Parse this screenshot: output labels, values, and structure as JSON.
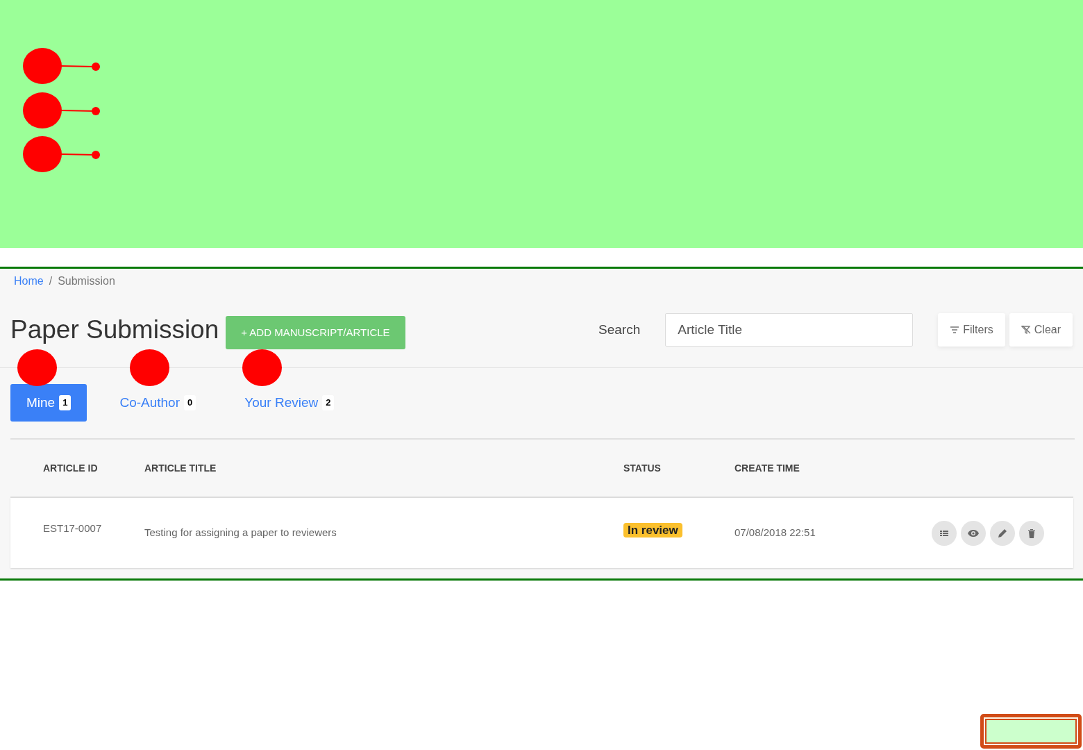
{
  "breadcrumb": [
    {
      "label": "Home",
      "kind": "link"
    },
    {
      "label": "/",
      "kind": "separator"
    },
    {
      "label": "Submission",
      "kind": "current"
    }
  ],
  "title": "Paper Submission",
  "add_button": "+ ADD MANUSCRIPT/ARTICLE",
  "search": {
    "label": "Search",
    "placeholder": "Article Title"
  },
  "filter_buttons": [
    {
      "kind": "filter",
      "label": "Filters"
    },
    {
      "kind": "clear",
      "label": "Clear"
    }
  ],
  "tabs": [
    {
      "label": "Mine",
      "count": "1",
      "selected": true
    },
    {
      "label": "Co-Author",
      "count": "0",
      "selected": false
    },
    {
      "label": "Your Review",
      "count": "2",
      "selected": false
    }
  ],
  "table": {
    "columns": [
      "ARTICLE ID",
      "ARTICLE TITLE",
      "STATUS",
      "CREATE TIME"
    ],
    "rows": [
      {
        "id": "EST17-0007",
        "title": "Testing for assigning a paper to reviewers",
        "status": "In review",
        "time": "07/08/2018 22:51"
      }
    ]
  }
}
